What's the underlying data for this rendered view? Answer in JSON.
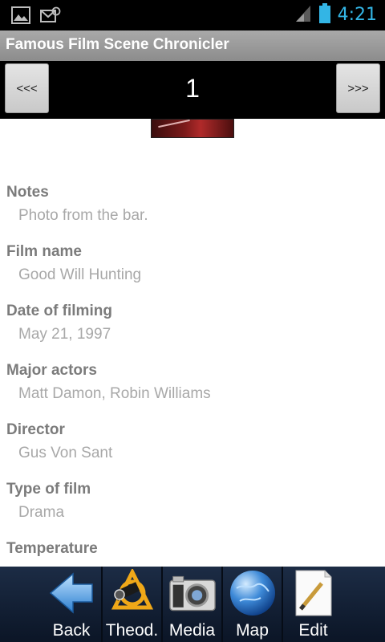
{
  "status_bar": {
    "time": "4:21",
    "icons": [
      "picture-icon",
      "mail-icon",
      "signal-icon",
      "battery-icon"
    ]
  },
  "app": {
    "title": "Famous Film Scene Chronicler"
  },
  "nav": {
    "prev_label": "<<<",
    "page_number": "1",
    "next_label": ">>>"
  },
  "fields": [
    {
      "label": "Notes",
      "value": "Photo from the bar."
    },
    {
      "label": "Film name",
      "value": "Good Will Hunting"
    },
    {
      "label": "Date of filming",
      "value": "May 21, 1997"
    },
    {
      "label": "Major actors",
      "value": "Matt Damon, Robin Williams"
    },
    {
      "label": "Director",
      "value": "Gus Von Sant"
    },
    {
      "label": "Type of film",
      "value": "Drama"
    },
    {
      "label": "Temperature",
      "value": ""
    }
  ],
  "toolbar": {
    "items": [
      {
        "label": "Back",
        "icon": "back-arrow-icon"
      },
      {
        "label": "Theod.",
        "icon": "theodolite-icon"
      },
      {
        "label": "Media",
        "icon": "camera-icon"
      },
      {
        "label": "Map",
        "icon": "globe-icon"
      },
      {
        "label": "Edit",
        "icon": "edit-pencil-icon"
      }
    ]
  },
  "colors": {
    "status_time": "#33b5e5",
    "title_bar": "#9b9b9b",
    "label_text": "#7b7b7b",
    "value_text": "#a8a8a8",
    "toolbar_bg": "#14223a"
  }
}
